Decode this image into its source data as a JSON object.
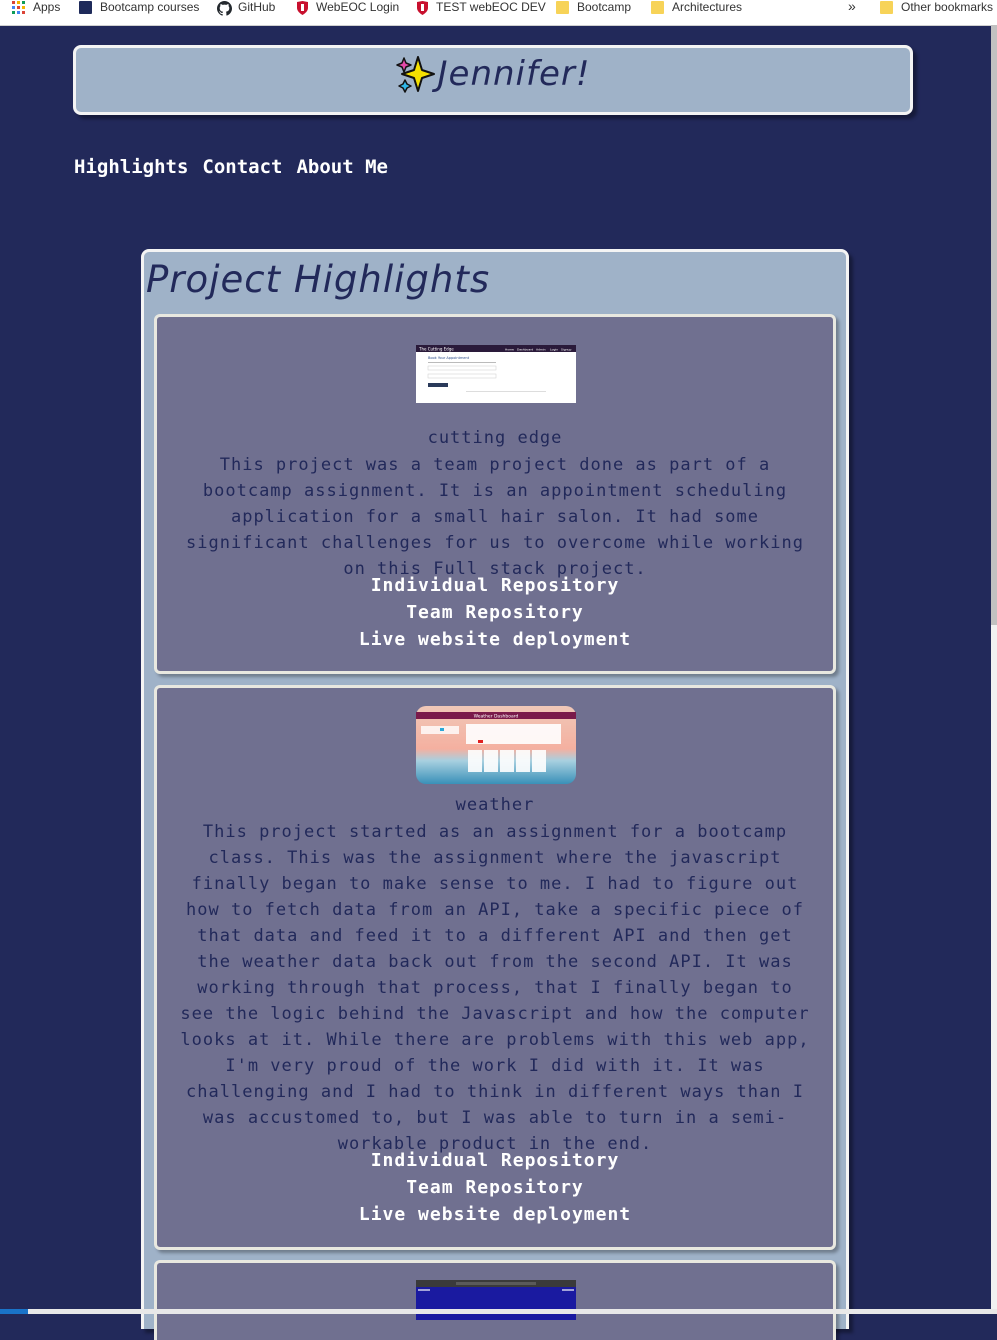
{
  "bookmarks": {
    "items": [
      {
        "label": "Apps",
        "icon": "apps-grid-icon"
      },
      {
        "label": "Bootcamp courses",
        "icon": "bootcamp-logo-icon"
      },
      {
        "label": "GitHub",
        "icon": "github-icon"
      },
      {
        "label": "WebEOC Login",
        "icon": "shield-icon"
      },
      {
        "label": "TEST webEOC DEV",
        "icon": "shield-icon"
      },
      {
        "label": "Bootcamp",
        "icon": "folder-icon"
      },
      {
        "label": "Architectures",
        "icon": "folder-icon"
      }
    ],
    "more": "»",
    "other": "Other bookmarks"
  },
  "header": {
    "icon": "sparkles-icon",
    "title": "Jennifer!"
  },
  "nav": [
    "Highlights",
    "Contact",
    "About Me"
  ],
  "section": {
    "title": "Project Highlights"
  },
  "projects": [
    {
      "name": "cutting edge",
      "description": "This project was a team project done as part of a bootcamp assignment. It is an appointment scheduling application for a small hair salon. It had some significant challenges for us to overcome while working on this Full stack project.",
      "thumbnail": {
        "site_title": "The Cutting Edge",
        "site_nav": [
          "Home",
          "Dashboard",
          "Admin",
          "Login",
          "Signup"
        ],
        "heading": "Book Your Appointment"
      },
      "links": [
        "Individual Repository",
        "Team Repository",
        "Live website deployment"
      ]
    },
    {
      "name": "weather",
      "description": "This project started as an assignment for a bootcamp class. This was the assignment where the javascript finally began to make sense to me. I had to figure out how to fetch data from an API, take a specific piece of that data and feed it to a different API and then get the weather data back out from the second API. It was working through that process, that I finally began to see the logic behind the Javascript and how the computer looks at it. While there are problems with this web app, I'm very proud of the work I did with it. It was challenging and I had to think in different ways than I was accustomed to, but I was able to turn in a semi-workable product in the end.",
      "thumbnail": {
        "site_title": "Weather Dashboard"
      },
      "links": [
        "Individual Repository",
        "Team Repository",
        "Live website deployment"
      ]
    }
  ],
  "colors": {
    "page_bg": "#22295a",
    "panel_bg": "#9fb2c8",
    "card_bg": "#707090",
    "card_border": "#e8e8e0",
    "link_text": "#ffffff"
  }
}
